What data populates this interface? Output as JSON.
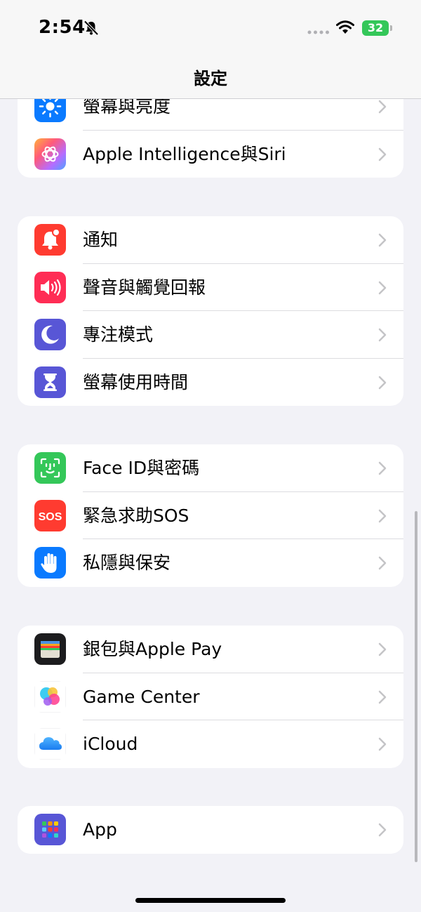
{
  "status": {
    "time": "2:54",
    "battery": "32"
  },
  "nav": {
    "title": "設定"
  },
  "groups": [
    {
      "rows": [
        {
          "label": "螢幕與亮度",
          "icon": "brightness-icon"
        },
        {
          "label": "Apple Intelligence與Siri",
          "icon": "apple-intelligence-icon"
        }
      ]
    },
    {
      "rows": [
        {
          "label": "通知",
          "icon": "notifications-icon"
        },
        {
          "label": "聲音與觸覺回報",
          "icon": "sound-icon"
        },
        {
          "label": "專注模式",
          "icon": "focus-moon-icon"
        },
        {
          "label": "螢幕使用時間",
          "icon": "hourglass-icon"
        }
      ]
    },
    {
      "rows": [
        {
          "label": "Face ID與密碼",
          "icon": "face-id-icon"
        },
        {
          "label": "緊急求助SOS",
          "icon": "sos-icon",
          "icon_text": "SOS"
        },
        {
          "label": "私隱與保安",
          "icon": "privacy-hand-icon"
        }
      ]
    },
    {
      "rows": [
        {
          "label": "銀包與Apple Pay",
          "icon": "wallet-icon"
        },
        {
          "label": "Game Center",
          "icon": "game-center-icon"
        },
        {
          "label": "iCloud",
          "icon": "icloud-icon"
        }
      ]
    },
    {
      "rows": [
        {
          "label": "App",
          "icon": "app-grid-icon"
        }
      ]
    }
  ],
  "colors": {
    "background": "#f2f2f7",
    "brightness": "#0a7aff",
    "notifications": "#ff3b30",
    "sound": "#ff2d55",
    "focus": "#5856d6",
    "screen_time": "#5856d6",
    "face_id": "#34c759",
    "sos": "#ff3b30",
    "privacy": "#0a7aff",
    "battery": "#34c759"
  }
}
